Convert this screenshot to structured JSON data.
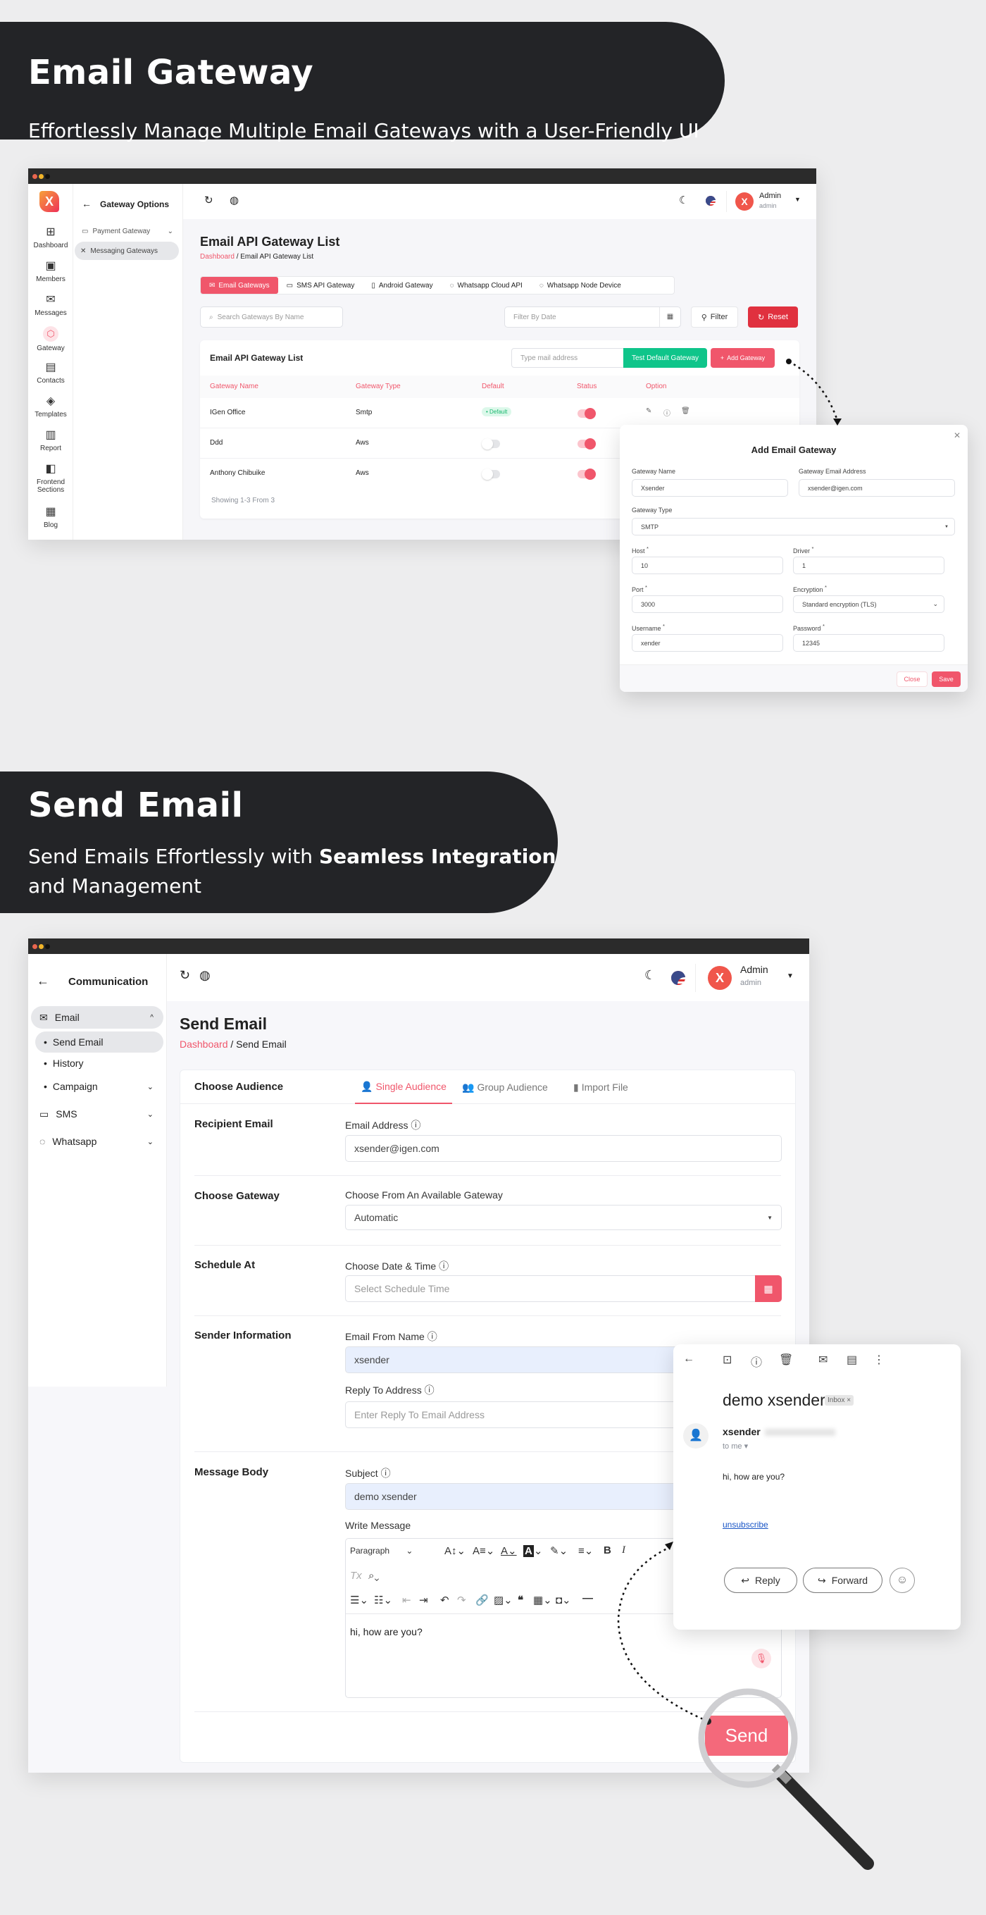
{
  "banner1": {
    "title": "Email Gateway",
    "subtitle": "Effortlessly Manage Multiple Email Gateways with a User-Friendly UI"
  },
  "banner2": {
    "title": "Send Email",
    "subtitle_pre": "Send Emails Effortlessly with ",
    "subtitle_bold": "Seamless Integration",
    "subtitle_post": "and Management"
  },
  "colors": {
    "accent": "#f0566b",
    "green": "#0fc58a",
    "reset": "#e0313f",
    "dark": "#232427"
  },
  "app1": {
    "icon_sidebar": [
      {
        "label": "Dashboard",
        "icon": "grid-icon"
      },
      {
        "label": "Members",
        "icon": "id-card-icon"
      },
      {
        "label": "Messages",
        "icon": "mail-icon"
      },
      {
        "label": "Gateway",
        "icon": "gateway-icon"
      },
      {
        "label": "Contacts",
        "icon": "contacts-icon"
      },
      {
        "label": "Templates",
        "icon": "layers-icon"
      },
      {
        "label": "Report",
        "icon": "bar-chart-icon"
      },
      {
        "label": "Frontend Sections",
        "icon": "layout-icon"
      },
      {
        "label": "Blog",
        "icon": "newspaper-icon"
      }
    ],
    "sub_sidebar": {
      "title": "Gateway Options",
      "items": [
        {
          "label": "Payment Gateway"
        },
        {
          "label": "Messaging Gateways"
        }
      ]
    },
    "user": {
      "name": "Admin",
      "role": "admin"
    },
    "page_title": "Email API Gateway List",
    "breadcrumb": {
      "home": "Dashboard",
      "current": "Email API Gateway List"
    },
    "tabs": [
      {
        "label": "Email Gateways"
      },
      {
        "label": "SMS API Gateway"
      },
      {
        "label": "Android Gateway"
      },
      {
        "label": "Whatsapp Cloud API"
      },
      {
        "label": "Whatsapp Node Device"
      }
    ],
    "search_placeholder": "Search Gateways By Name",
    "date_placeholder": "Filter By Date",
    "filter_label": "Filter",
    "reset_label": "Reset",
    "card_title": "Email API Gateway List",
    "mail_placeholder": "Type mail address",
    "test_label": "Test Default Gateway",
    "add_label": "Add Gateway",
    "columns": [
      "Gateway Name",
      "Gateway Type",
      "Default",
      "Status",
      "Option"
    ],
    "rows": [
      {
        "name": "IGen Office",
        "type": "Smtp",
        "default": "Default",
        "is_default": true,
        "status_on": true
      },
      {
        "name": "Ddd",
        "type": "Aws",
        "default": "",
        "is_default": false,
        "status_on": true
      },
      {
        "name": "Anthony Chibuike",
        "type": "Aws",
        "default": "",
        "is_default": false,
        "status_on": true
      }
    ],
    "showing": "Showing 1-3 From 3"
  },
  "modal": {
    "title": "Add Email Gateway",
    "gateway_name_label": "Gateway Name",
    "gateway_name": "Xsender",
    "gateway_email_label": "Gateway Email Address",
    "gateway_email": "xsender@igen.com",
    "gateway_type_label": "Gateway Type",
    "gateway_type": "SMTP",
    "host_label": "Host",
    "host": "10",
    "driver_label": "Driver",
    "driver": "1",
    "port_label": "Port",
    "port": "3000",
    "encryption_label": "Encryption",
    "encryption": "Standard encryption (TLS)",
    "username_label": "Username",
    "username": "xender",
    "password_label": "Password",
    "password": "12345",
    "required_mark": "*",
    "close_label": "Close",
    "save_label": "Save"
  },
  "app2": {
    "sidebar": {
      "title": "Communication",
      "email": "Email",
      "items": [
        {
          "label": "Send Email"
        },
        {
          "label": "History"
        },
        {
          "label": "Campaign"
        }
      ],
      "sms": "SMS",
      "whatsapp": "Whatsapp"
    },
    "user": {
      "name": "Admin",
      "role": "admin"
    },
    "page_title": "Send Email",
    "breadcrumb": {
      "home": "Dashboard",
      "current": "Send Email"
    },
    "audience_title": "Choose Audience",
    "tabs": [
      {
        "label": "Single Audience"
      },
      {
        "label": "Group Audience"
      },
      {
        "label": "Import File"
      }
    ],
    "sections": {
      "recipient": {
        "title": "Recipient Email",
        "label": "Email Address",
        "value": "xsender@igen.com"
      },
      "gateway": {
        "title": "Choose Gateway",
        "label": "Choose From An Available Gateway",
        "value": "Automatic"
      },
      "schedule": {
        "title": "Schedule At",
        "label": "Choose Date & Time",
        "placeholder": "Select Schedule Time"
      },
      "sender": {
        "title": "Sender Information",
        "from_label": "Email From Name",
        "from_value": "xsender",
        "reply_label": "Reply To Address",
        "reply_placeholder": "Enter Reply To Email Address"
      },
      "message": {
        "title": "Message Body",
        "subject_label": "Subject",
        "subject_value": "demo xsender",
        "write_label": "Write Message",
        "paragraph": "Paragraph",
        "body": "hi, how are you?"
      }
    },
    "send_label": "Send"
  },
  "gmail": {
    "subject": "demo xsender",
    "badge": "Inbox",
    "sender": "xsender",
    "to": "to me",
    "body": "hi, how are you?",
    "unsubscribe": "unsubscribe",
    "reply": "Reply",
    "forward": "Forward"
  }
}
